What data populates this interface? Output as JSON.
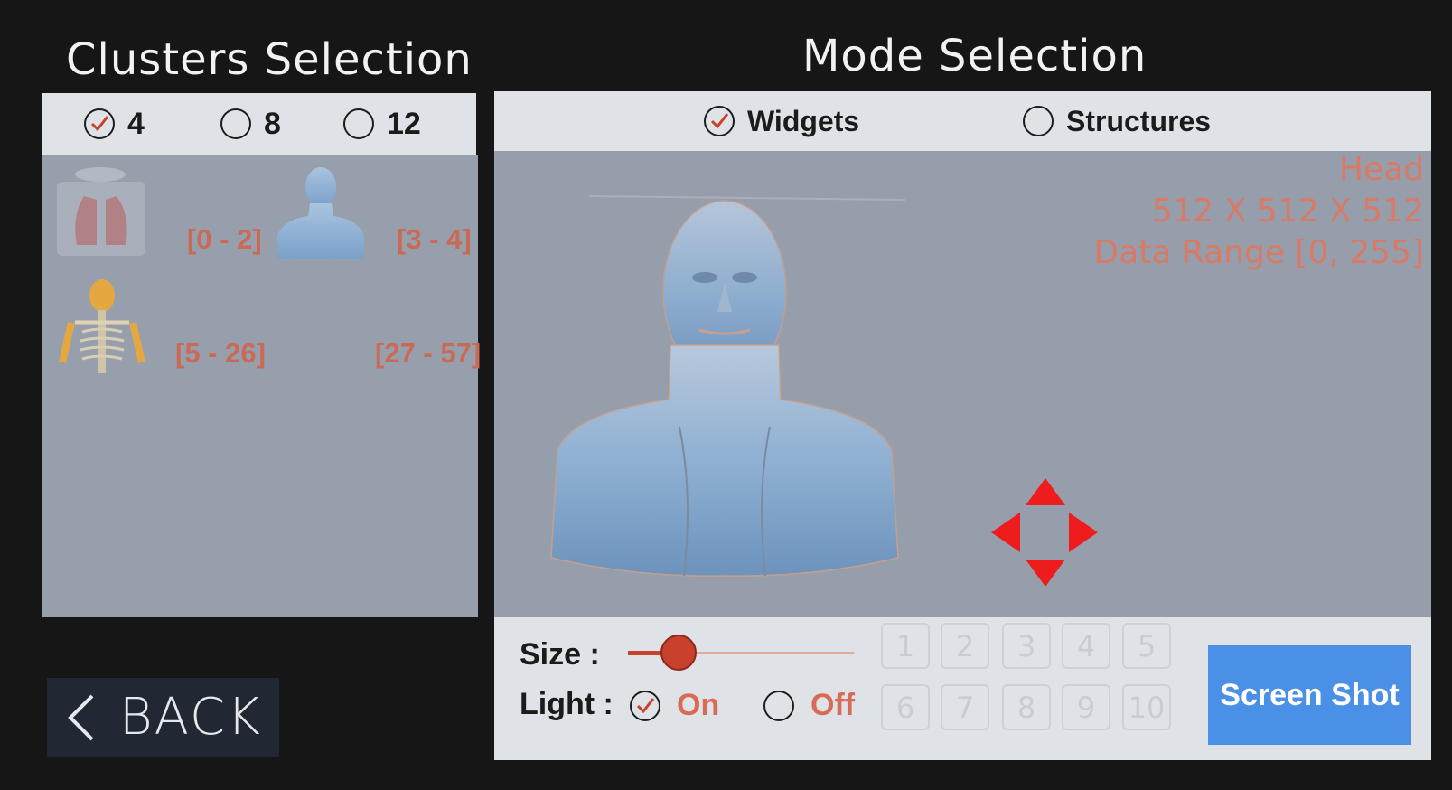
{
  "clusters": {
    "title": "Clusters Selection",
    "options": [
      {
        "label": "4",
        "checked": true
      },
      {
        "label": "8",
        "checked": false
      },
      {
        "label": "12",
        "checked": false
      }
    ],
    "items": [
      {
        "range": "[0 - 2]",
        "thumb": "lungs-thumbnail"
      },
      {
        "range": "[3 - 4]",
        "thumb": "head-bust-thumbnail"
      },
      {
        "range": "[5 - 26]",
        "thumb": "skeleton-thumbnail"
      },
      {
        "range": "[27 - 57]",
        "thumb": "empty"
      }
    ]
  },
  "mode": {
    "title": "Mode Selection",
    "options": [
      {
        "label": "Widgets",
        "checked": true
      },
      {
        "label": "Structures",
        "checked": false
      }
    ]
  },
  "viewer": {
    "info_lines": [
      "Head",
      "512 X 512 X 512",
      "Data Range [0, 255]"
    ]
  },
  "controls": {
    "size_label": "Size :",
    "size_value": 0.17,
    "light_label": "Light :",
    "light_on": "On",
    "light_off": "Off",
    "light_selected": "On",
    "numbers": [
      "1",
      "2",
      "3",
      "4",
      "5",
      "6",
      "7",
      "8",
      "9",
      "10"
    ],
    "screenshot_label": "Screen Shot"
  },
  "back": {
    "label": "BACK"
  },
  "colors": {
    "background": "#161616",
    "panel": "#dfe3e8",
    "viewport": "#969eab",
    "accent_red": "#c9402c",
    "info_text": "#d97a66",
    "button_blue": "#4a90e6",
    "arrow_red": "#ee1c1c"
  }
}
